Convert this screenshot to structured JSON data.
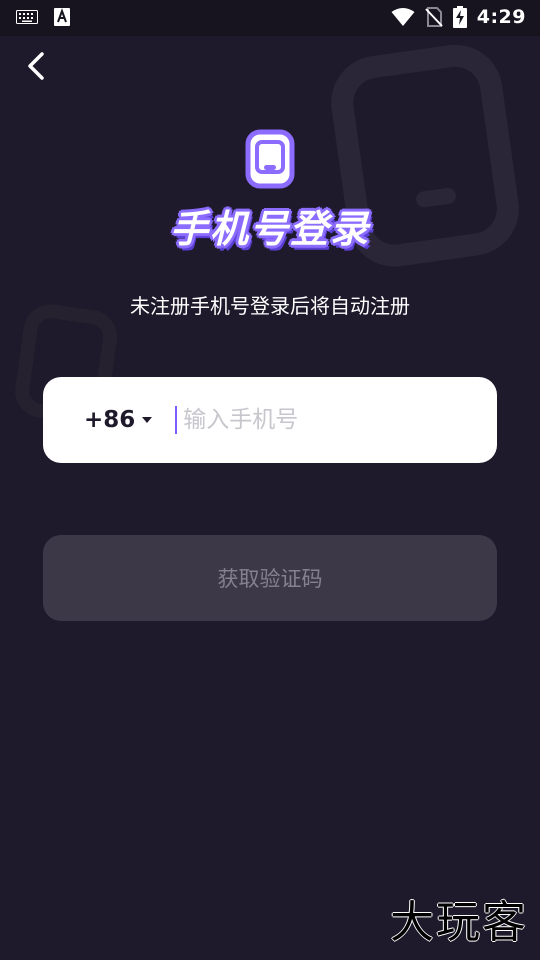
{
  "status_bar": {
    "time": "4:29"
  },
  "header": {
    "title": "手机号登录",
    "subtitle": "未注册手机号登录后将自动注册"
  },
  "phone_form": {
    "country_code": "+86",
    "phone_placeholder": "输入手机号",
    "phone_value": ""
  },
  "actions": {
    "get_code_label": "获取验证码"
  },
  "watermark": {
    "text": "大玩客"
  },
  "colors": {
    "background": "#1e1a2b",
    "accent": "#7c5cff",
    "disabled_button": "#3c3848"
  },
  "icons": {
    "back": "chevron-left-icon",
    "logo": "phone-icon",
    "country_dropdown": "caret-down-icon"
  }
}
